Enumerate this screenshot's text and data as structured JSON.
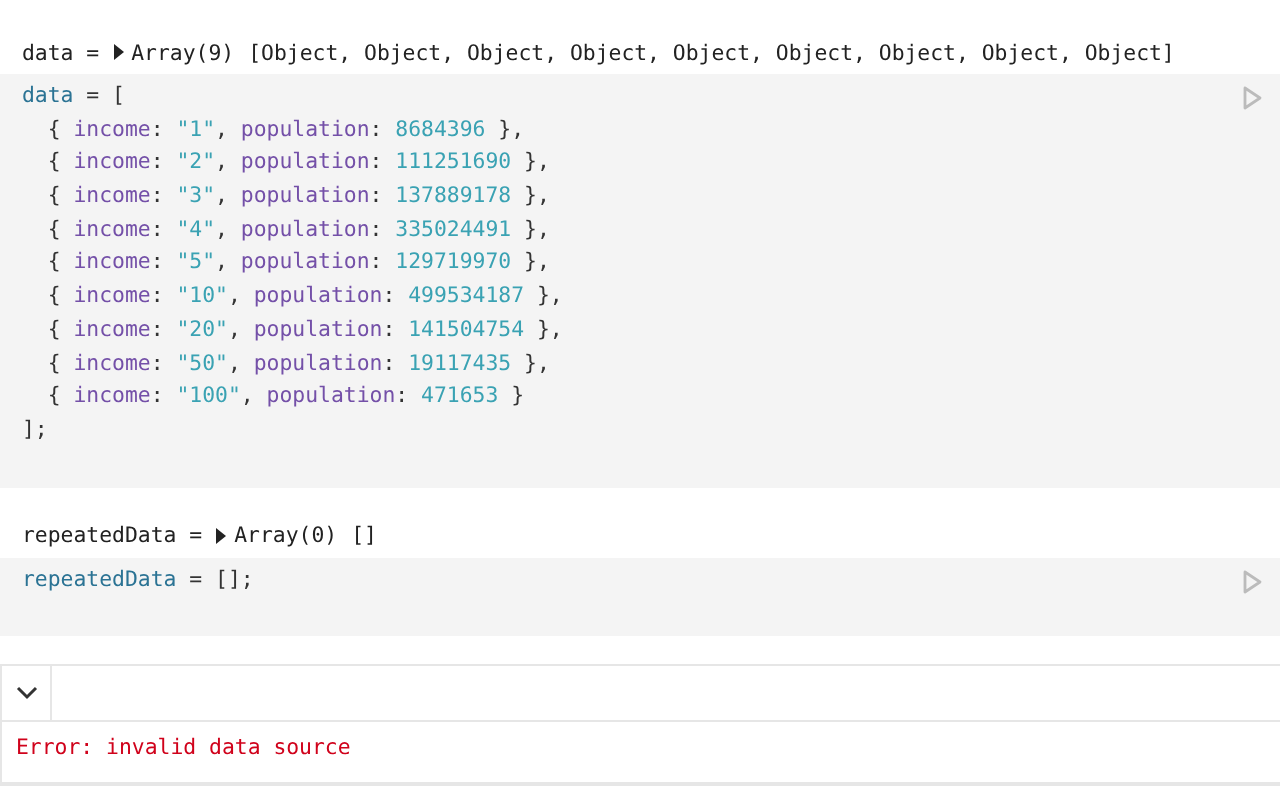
{
  "cells": [
    {
      "output": {
        "name": "data =",
        "type": "Array(9)",
        "summary": "[Object, Object, Object, Object, Object, Object, Object, Object, Object]"
      },
      "code": [
        [
          {
            "kind": "var",
            "text": "data"
          },
          {
            "kind": "punct",
            "text": " = ["
          }
        ],
        [
          {
            "kind": "punct",
            "text": "  { "
          },
          {
            "kind": "key",
            "text": "income"
          },
          {
            "kind": "punct",
            "text": ": "
          },
          {
            "kind": "str",
            "text": "\"1\""
          },
          {
            "kind": "punct",
            "text": ", "
          },
          {
            "kind": "key",
            "text": "population"
          },
          {
            "kind": "punct",
            "text": ": "
          },
          {
            "kind": "num",
            "text": "8684396"
          },
          {
            "kind": "punct",
            "text": " },"
          }
        ],
        [
          {
            "kind": "punct",
            "text": "  { "
          },
          {
            "kind": "key",
            "text": "income"
          },
          {
            "kind": "punct",
            "text": ": "
          },
          {
            "kind": "str",
            "text": "\"2\""
          },
          {
            "kind": "punct",
            "text": ", "
          },
          {
            "kind": "key",
            "text": "population"
          },
          {
            "kind": "punct",
            "text": ": "
          },
          {
            "kind": "num",
            "text": "111251690"
          },
          {
            "kind": "punct",
            "text": " },"
          }
        ],
        [
          {
            "kind": "punct",
            "text": "  { "
          },
          {
            "kind": "key",
            "text": "income"
          },
          {
            "kind": "punct",
            "text": ": "
          },
          {
            "kind": "str",
            "text": "\"3\""
          },
          {
            "kind": "punct",
            "text": ", "
          },
          {
            "kind": "key",
            "text": "population"
          },
          {
            "kind": "punct",
            "text": ": "
          },
          {
            "kind": "num",
            "text": "137889178"
          },
          {
            "kind": "punct",
            "text": " },"
          }
        ],
        [
          {
            "kind": "punct",
            "text": "  { "
          },
          {
            "kind": "key",
            "text": "income"
          },
          {
            "kind": "punct",
            "text": ": "
          },
          {
            "kind": "str",
            "text": "\"4\""
          },
          {
            "kind": "punct",
            "text": ", "
          },
          {
            "kind": "key",
            "text": "population"
          },
          {
            "kind": "punct",
            "text": ": "
          },
          {
            "kind": "num",
            "text": "335024491"
          },
          {
            "kind": "punct",
            "text": " },"
          }
        ],
        [
          {
            "kind": "punct",
            "text": "  { "
          },
          {
            "kind": "key",
            "text": "income"
          },
          {
            "kind": "punct",
            "text": ": "
          },
          {
            "kind": "str",
            "text": "\"5\""
          },
          {
            "kind": "punct",
            "text": ", "
          },
          {
            "kind": "key",
            "text": "population"
          },
          {
            "kind": "punct",
            "text": ": "
          },
          {
            "kind": "num",
            "text": "129719970"
          },
          {
            "kind": "punct",
            "text": " },"
          }
        ],
        [
          {
            "kind": "punct",
            "text": "  { "
          },
          {
            "kind": "key",
            "text": "income"
          },
          {
            "kind": "punct",
            "text": ": "
          },
          {
            "kind": "str",
            "text": "\"10\""
          },
          {
            "kind": "punct",
            "text": ", "
          },
          {
            "kind": "key",
            "text": "population"
          },
          {
            "kind": "punct",
            "text": ": "
          },
          {
            "kind": "num",
            "text": "499534187"
          },
          {
            "kind": "punct",
            "text": " },"
          }
        ],
        [
          {
            "kind": "punct",
            "text": "  { "
          },
          {
            "kind": "key",
            "text": "income"
          },
          {
            "kind": "punct",
            "text": ": "
          },
          {
            "kind": "str",
            "text": "\"20\""
          },
          {
            "kind": "punct",
            "text": ", "
          },
          {
            "kind": "key",
            "text": "population"
          },
          {
            "kind": "punct",
            "text": ": "
          },
          {
            "kind": "num",
            "text": "141504754"
          },
          {
            "kind": "punct",
            "text": " },"
          }
        ],
        [
          {
            "kind": "punct",
            "text": "  { "
          },
          {
            "kind": "key",
            "text": "income"
          },
          {
            "kind": "punct",
            "text": ": "
          },
          {
            "kind": "str",
            "text": "\"50\""
          },
          {
            "kind": "punct",
            "text": ", "
          },
          {
            "kind": "key",
            "text": "population"
          },
          {
            "kind": "punct",
            "text": ": "
          },
          {
            "kind": "num",
            "text": "19117435"
          },
          {
            "kind": "punct",
            "text": " },"
          }
        ],
        [
          {
            "kind": "punct",
            "text": "  { "
          },
          {
            "kind": "key",
            "text": "income"
          },
          {
            "kind": "punct",
            "text": ": "
          },
          {
            "kind": "str",
            "text": "\"100\""
          },
          {
            "kind": "punct",
            "text": ", "
          },
          {
            "kind": "key",
            "text": "population"
          },
          {
            "kind": "punct",
            "text": ": "
          },
          {
            "kind": "num",
            "text": "471653"
          },
          {
            "kind": "punct",
            "text": " }"
          }
        ],
        [
          {
            "kind": "punct",
            "text": "];"
          }
        ]
      ]
    },
    {
      "output": {
        "name": "repeatedData =",
        "type": "Array(0)",
        "summary": "[]"
      },
      "code": [
        [
          {
            "kind": "var",
            "text": "repeatedData"
          },
          {
            "kind": "punct",
            "text": " = [];"
          }
        ]
      ]
    }
  ],
  "error_cell": {
    "expanded": true,
    "message": "Error: invalid data source"
  }
}
